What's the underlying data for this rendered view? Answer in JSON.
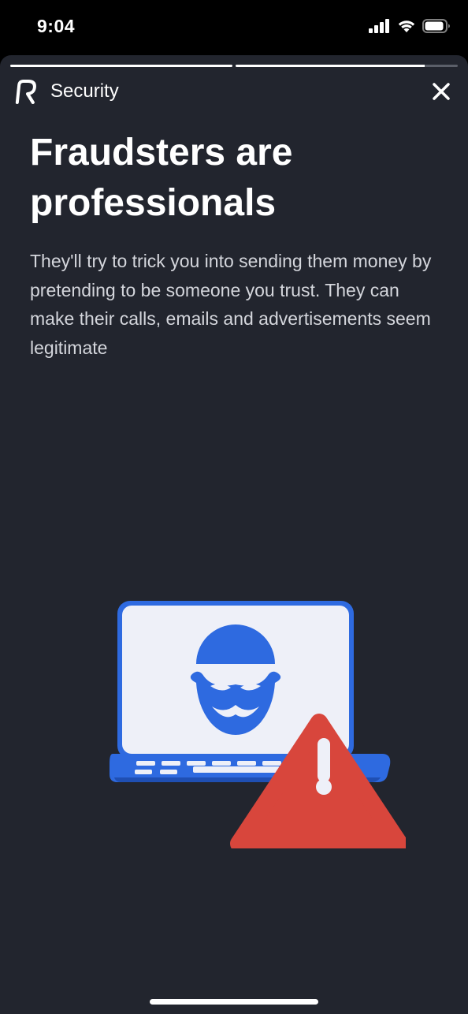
{
  "status_bar": {
    "time": "9:04",
    "icons": [
      "signal-icon",
      "wifi-icon",
      "battery-icon"
    ]
  },
  "progress": {
    "segments": [
      {
        "fill_fraction": 1.0
      },
      {
        "fill_fraction": 0.85
      }
    ]
  },
  "header": {
    "brand_icon": "revolut-logo-icon",
    "title": "Security",
    "close_icon": "close-icon"
  },
  "content": {
    "headline": "Fraudsters are professionals",
    "body": "They'll try to trick you into sending them money by pretending to be someone you trust. They can make their calls, emails and advertisements seem legitimate"
  },
  "illustration": {
    "icons": [
      "laptop-icon",
      "fraudster-mask-icon",
      "warning-icon"
    ]
  },
  "colors": {
    "background": "#22252e",
    "accent_blue": "#2e6ae0",
    "warning_red": "#d8463c",
    "text_primary": "#ffffff",
    "text_secondary": "#d4d6dc"
  }
}
